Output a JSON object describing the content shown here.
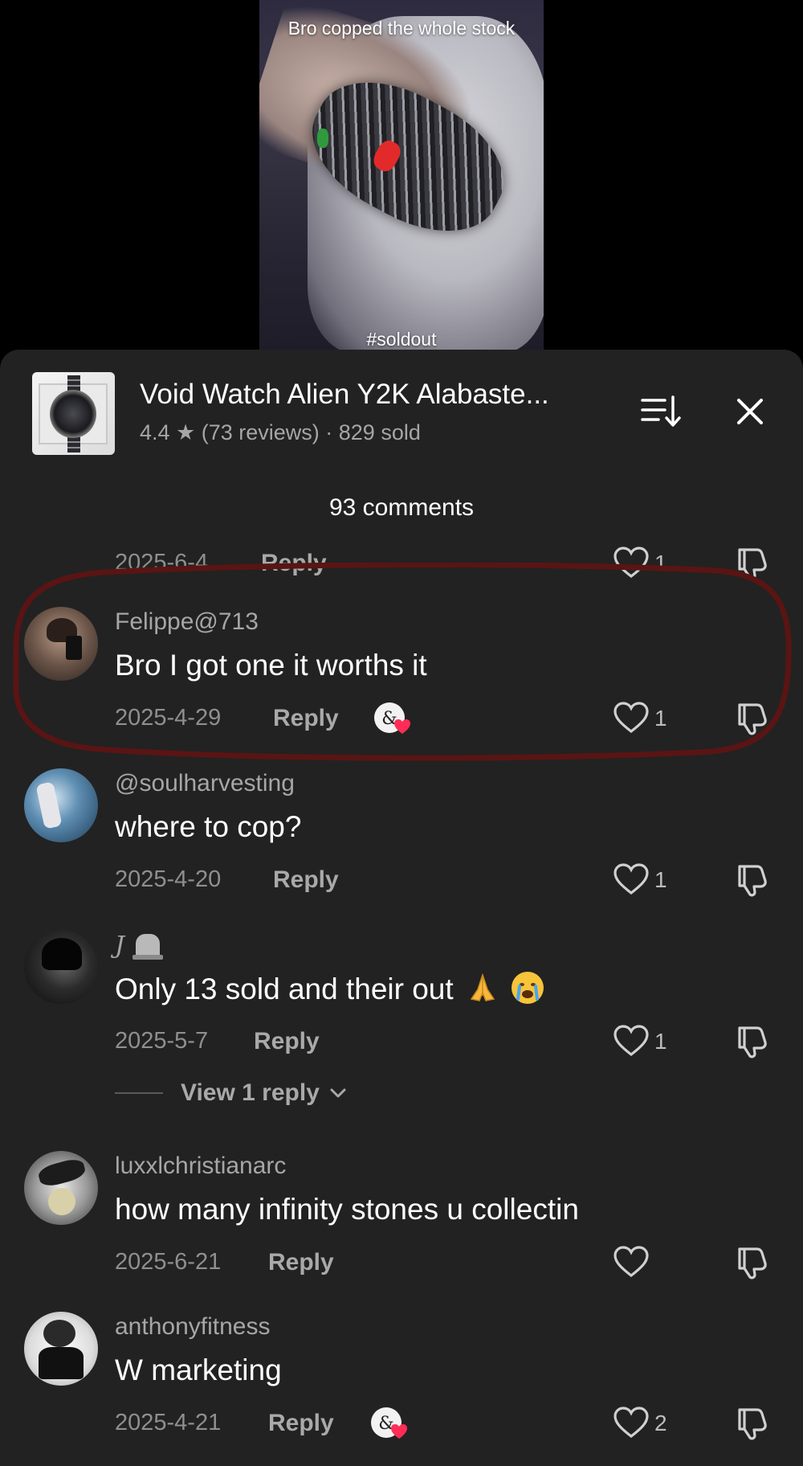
{
  "video": {
    "caption": "Bro copped the whole stock",
    "hashtag": "#soldout"
  },
  "product": {
    "title": "Void Watch Alien Y2K Alabaste...",
    "meta": "4.4 ★ (73 reviews) · 829 sold"
  },
  "comments_header": {
    "count_label": "93 comments"
  },
  "reply_label": "Reply",
  "colors": {
    "highlight": "#5a1414",
    "sheet_bg": "#222222",
    "like_badge": "#ff2d55"
  },
  "top_row": {
    "date": "2025-6-4",
    "likes": "1"
  },
  "comments": [
    {
      "user": "Felippe@713",
      "text": "Bro I got one it worths it",
      "date": "2025-4-29",
      "likes": "1",
      "creator_liked": true
    },
    {
      "user": "@soulharvesting",
      "text": "where to cop?",
      "date": "2025-4-20",
      "likes": "1",
      "creator_liked": false
    },
    {
      "user": "J",
      "text": "Only 13 sold and their out",
      "date": "2025-5-7",
      "likes": "1",
      "creator_liked": false,
      "view_replies": "View 1 reply"
    },
    {
      "user": "luxxlchristianarc",
      "text": "how many infinity stones u collectin",
      "date": "2025-6-21",
      "likes": "",
      "creator_liked": false
    },
    {
      "user": "anthonyfitness",
      "text": "W marketing",
      "date": "2025-4-21",
      "likes": "2",
      "creator_liked": true
    }
  ]
}
